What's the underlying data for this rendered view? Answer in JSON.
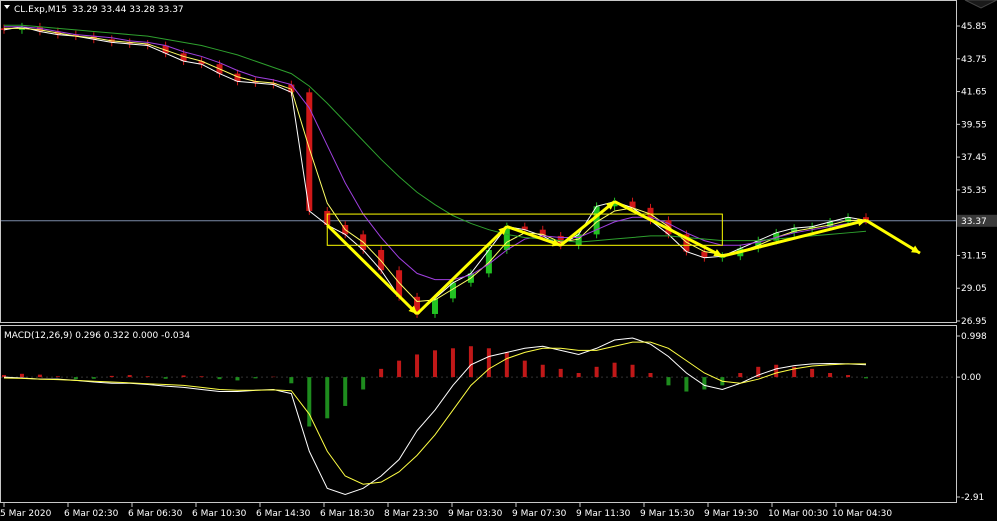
{
  "header": {
    "symbol_timeframe": "CL.Exp,M15",
    "ohlc": "33.29 33.44 33.28 33.37"
  },
  "macd_header": "MACD(12,26,9) 0.296 0.322 0.000 -0.034",
  "colors": {
    "background": "#000000",
    "grid": "#1e1e1e",
    "axis": "#c8c8c8",
    "bull": "#22c222",
    "bear": "#d01818",
    "ma_fast": "#ffffff",
    "ma_mid": "#ffff66",
    "ma_slow1": "#a040e0",
    "ma_slow2": "#2ea02e",
    "arrow": "#ffff00",
    "hist_pos": "#c01818",
    "hist_neg": "#1e8c1e",
    "macd_line": "#ffffff",
    "signal_line": "#ffff44",
    "bid_line": "#7a8aa8",
    "price_tag": "#3a3a3a"
  },
  "chart_data": [
    {
      "type": "line",
      "title": "CL.Exp,M15",
      "y_ticks": [
        "45.85",
        "43.75",
        "41.65",
        "39.55",
        "37.45",
        "35.35",
        "33.37",
        "31.15",
        "29.05",
        "26.95"
      ],
      "ylim": [
        26.95,
        45.85
      ],
      "current_price": 33.37,
      "x_ticks": [
        "5 Mar 2020",
        "6 Mar 02:30",
        "6 Mar 06:30",
        "6 Mar 10:30",
        "6 Mar 14:30",
        "6 Mar 18:30",
        "8 Mar 23:30",
        "9 Mar 03:30",
        "9 Mar 07:30",
        "9 Mar 11:30",
        "9 Mar 15:30",
        "9 Mar 19:30",
        "10 Mar 00:30",
        "10 Mar 04:30"
      ],
      "series": [
        {
          "values": [
            45.6,
            45.8,
            45.5,
            45.3,
            45.2,
            45.0,
            44.8,
            44.7,
            44.6,
            44.1,
            43.6,
            43.4,
            42.8,
            42.3,
            42.2,
            42.1,
            41.6,
            34.0,
            33.1,
            32.5,
            31.5,
            30.2,
            28.5,
            27.4,
            28.4,
            29.4,
            30.0,
            31.5,
            33.0,
            32.8,
            32.4,
            31.8,
            32.5,
            34.3,
            34.6,
            34.2,
            33.4,
            32.5,
            31.4,
            31.0,
            31.1,
            31.6,
            32.1,
            32.6,
            32.9,
            33.0,
            33.3,
            33.6,
            33.4
          ]
        },
        {
          "values": [
            45.7,
            45.7,
            45.6,
            45.4,
            45.2,
            45.1,
            44.9,
            44.8,
            44.7,
            44.3,
            43.9,
            43.6,
            43.1,
            42.6,
            42.3,
            42.2,
            41.8,
            38.0,
            34.5,
            32.8,
            32.0,
            30.8,
            29.4,
            28.2,
            28.3,
            29.0,
            29.7,
            30.7,
            32.0,
            32.6,
            32.5,
            32.0,
            32.2,
            33.3,
            34.0,
            34.2,
            33.8,
            33.0,
            32.0,
            31.4,
            31.2,
            31.4,
            31.8,
            32.3,
            32.7,
            32.9,
            33.1,
            33.4,
            33.4
          ]
        },
        {
          "values": [
            45.8,
            45.8,
            45.7,
            45.5,
            45.3,
            45.2,
            45.1,
            44.9,
            44.8,
            44.6,
            44.2,
            43.9,
            43.5,
            43.0,
            42.6,
            42.4,
            42.1,
            40.6,
            38.2,
            35.8,
            33.8,
            32.3,
            31.0,
            30.0,
            29.6,
            29.6,
            29.9,
            30.6,
            31.5,
            32.2,
            32.4,
            32.3,
            32.3,
            32.8,
            33.3,
            33.6,
            33.6,
            33.2,
            32.6,
            32.1,
            31.8,
            31.8,
            32.0,
            32.3,
            32.6,
            32.8,
            33.0,
            33.2,
            33.3
          ]
        },
        {
          "values": [
            45.9,
            45.9,
            45.8,
            45.7,
            45.6,
            45.5,
            45.4,
            45.3,
            45.2,
            45.0,
            44.8,
            44.6,
            44.3,
            44.0,
            43.6,
            43.2,
            42.8,
            42.0,
            40.9,
            39.7,
            38.5,
            37.3,
            36.2,
            35.2,
            34.4,
            33.7,
            33.2,
            32.8,
            32.5,
            32.3,
            32.2,
            32.1,
            32.0,
            32.1,
            32.2,
            32.3,
            32.4,
            32.4,
            32.3,
            32.2,
            32.1,
            32.1,
            32.1,
            32.2,
            32.3,
            32.4,
            32.5,
            32.6,
            32.7
          ]
        }
      ]
    },
    {
      "type": "bar",
      "title": "MACD(12,26,9)",
      "y_ticks": [
        "0.998",
        "0.00",
        "-2.91"
      ],
      "ylim": [
        -2.91,
        0.998
      ],
      "histogram": [
        0.05,
        0.08,
        0.06,
        0.02,
        -0.05,
        -0.04,
        0.03,
        0.05,
        0.02,
        -0.04,
        0.04,
        0.02,
        -0.05,
        -0.08,
        -0.03,
        0.01,
        -0.15,
        -1.2,
        -1.0,
        -0.7,
        -0.3,
        0.2,
        0.4,
        0.55,
        0.65,
        0.7,
        0.75,
        0.7,
        0.6,
        0.4,
        0.3,
        0.2,
        0.1,
        0.25,
        0.35,
        0.3,
        0.1,
        -0.2,
        -0.35,
        -0.3,
        -0.2,
        0.1,
        0.25,
        0.3,
        0.25,
        0.2,
        0.1,
        0.05,
        -0.03
      ],
      "series": [
        {
          "values": [
            0.0,
            -0.02,
            -0.05,
            -0.05,
            -0.08,
            -0.12,
            -0.15,
            -0.15,
            -0.18,
            -0.22,
            -0.25,
            -0.3,
            -0.35,
            -0.35,
            -0.32,
            -0.3,
            -0.4,
            -1.8,
            -2.7,
            -2.85,
            -2.7,
            -2.4,
            -2.0,
            -1.3,
            -0.8,
            -0.2,
            0.3,
            0.5,
            0.6,
            0.7,
            0.75,
            0.65,
            0.55,
            0.7,
            0.9,
            0.95,
            0.8,
            0.5,
            0.1,
            -0.2,
            -0.3,
            -0.15,
            0.05,
            0.2,
            0.28,
            0.32,
            0.33,
            0.32,
            0.3
          ]
        },
        {
          "values": [
            -0.02,
            -0.03,
            -0.05,
            -0.06,
            -0.08,
            -0.1,
            -0.12,
            -0.14,
            -0.16,
            -0.18,
            -0.2,
            -0.25,
            -0.3,
            -0.32,
            -0.32,
            -0.31,
            -0.33,
            -0.9,
            -1.8,
            -2.4,
            -2.6,
            -2.55,
            -2.3,
            -1.9,
            -1.4,
            -0.8,
            -0.2,
            0.2,
            0.45,
            0.6,
            0.7,
            0.7,
            0.65,
            0.65,
            0.75,
            0.85,
            0.85,
            0.7,
            0.4,
            0.1,
            -0.1,
            -0.15,
            -0.05,
            0.1,
            0.2,
            0.27,
            0.3,
            0.32,
            0.32
          ]
        }
      ]
    }
  ]
}
